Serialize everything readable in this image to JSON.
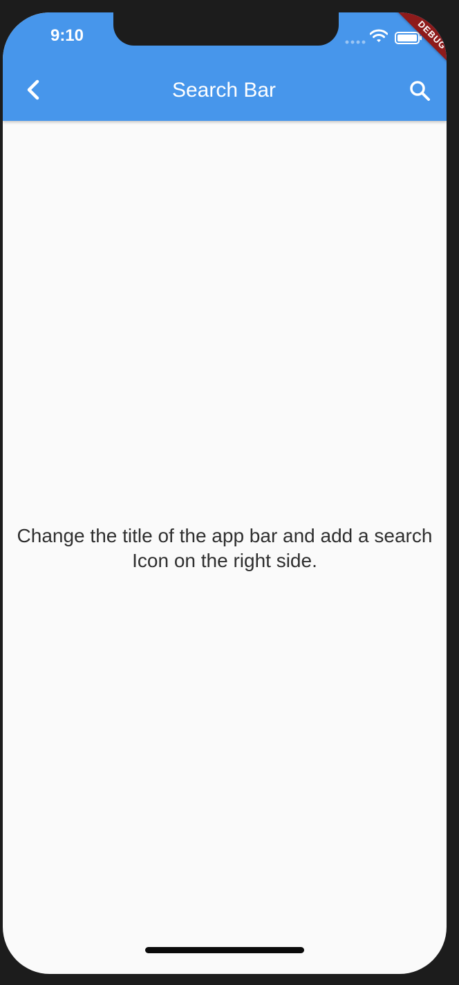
{
  "status_bar": {
    "time": "9:10"
  },
  "app_bar": {
    "title": "Search Bar",
    "back_icon": "chevron-left-icon",
    "action_icon": "search-icon",
    "background_color": "#4796eb"
  },
  "debug_banner": {
    "label": "DEBUG",
    "color": "#8e1b1b"
  },
  "body": {
    "message": "Change the title of the app bar and add a search Icon on the right side."
  }
}
